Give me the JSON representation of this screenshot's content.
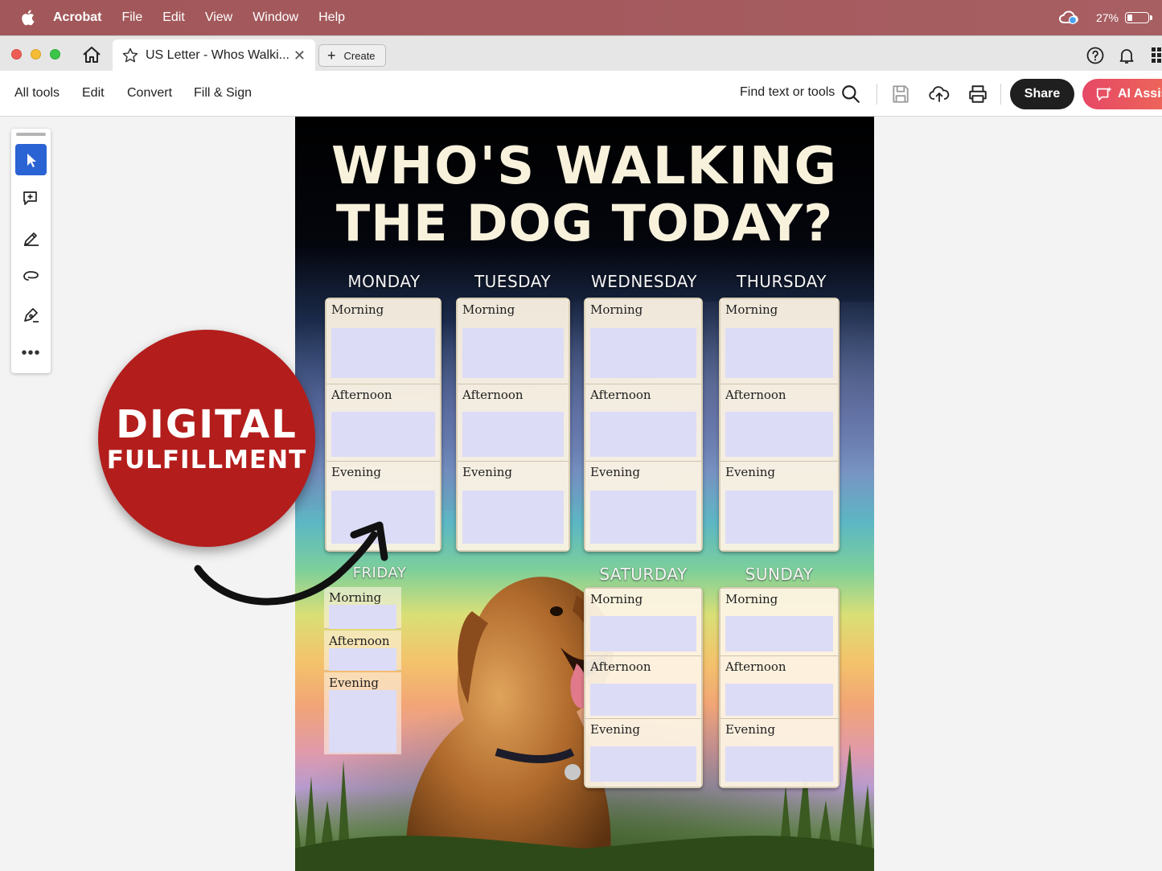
{
  "menubar": {
    "app": "Acrobat",
    "items": [
      "File",
      "Edit",
      "View",
      "Window",
      "Help"
    ],
    "battery_percent": "27%",
    "battery_level": 0.27
  },
  "tabbar": {
    "tab_title": "US Letter - Whos Walki...",
    "create_label": "Create"
  },
  "toolbar": {
    "menus": [
      "All tools",
      "Edit",
      "Convert",
      "Fill & Sign"
    ],
    "find_label": "Find text or tools",
    "share_label": "Share",
    "ai_label": "AI Assis"
  },
  "document": {
    "title_line1": "WHO'S WALKING",
    "title_line2": "THE DOG TODAY?",
    "days": [
      "MONDAY",
      "TUESDAY",
      "WEDNESDAY",
      "THURSDAY",
      "FRIDAY",
      "SATURDAY",
      "SUNDAY"
    ],
    "slots": [
      "Morning",
      "Afternoon",
      "Evening"
    ]
  },
  "badge": {
    "line1": "DIGITAL",
    "line2": "FULFILLMENT",
    "color": "#b31d1c"
  },
  "colors": {
    "menubar": "#a45a5d",
    "share_bg": "#1f1f1f",
    "ai_gradient_start": "#e64866",
    "active_tool": "#2a63d4",
    "field_fill": "#dcdcf7"
  }
}
